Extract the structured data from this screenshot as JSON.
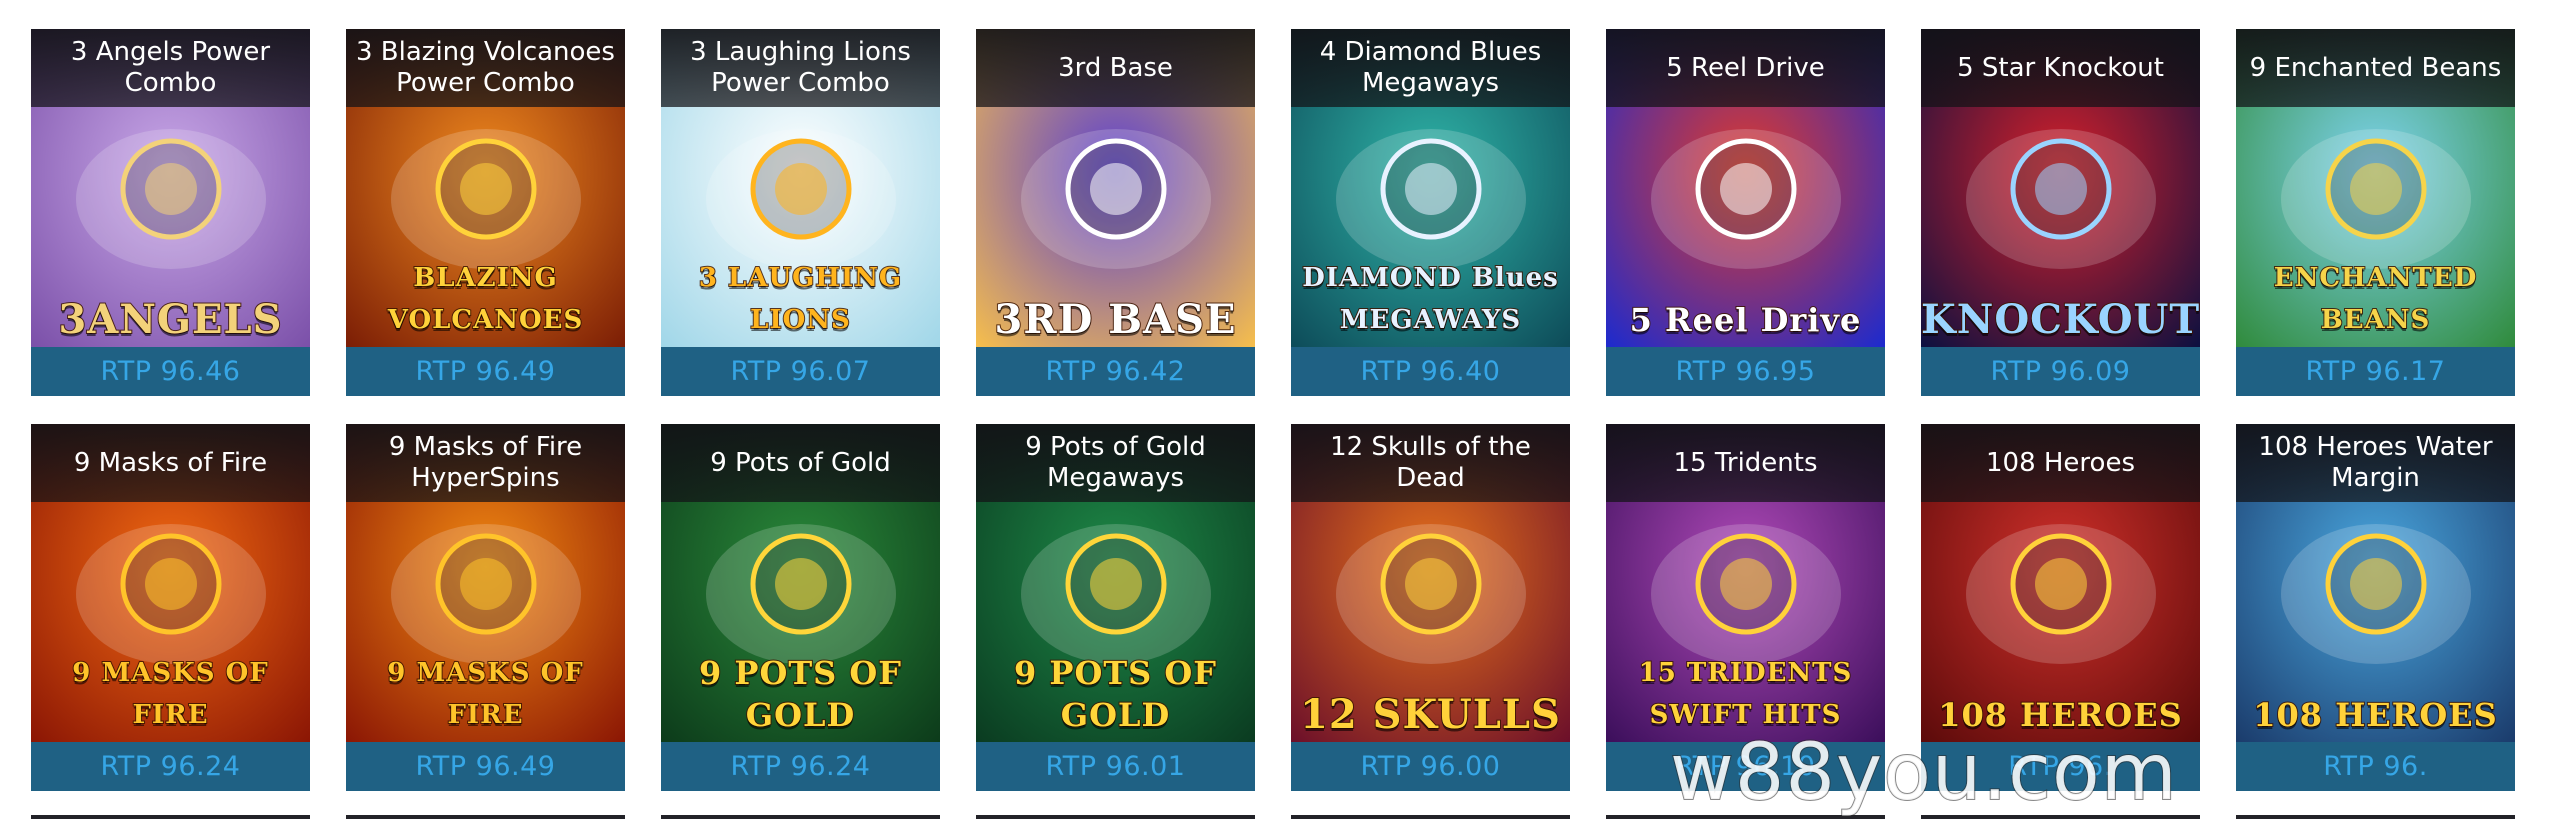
{
  "watermark": "w88you.com",
  "games": [
    {
      "title": "3 Angels Power Combo",
      "rtp": "RTP 96.46",
      "logo": "3ANGELS",
      "bg": [
        "#c9a8e8",
        "#7a4fa8"
      ],
      "logo_color": "#f3d27a",
      "thumb_icon": "angels-art"
    },
    {
      "title": "3 Blazing Volcanoes Power Combo",
      "rtp": "RTP 96.49",
      "logo": "BLAZING VOLCANOES",
      "bg": [
        "#f08a1e",
        "#7a1c05"
      ],
      "logo_color": "#ffd23a",
      "thumb_icon": "volcano-art"
    },
    {
      "title": "3 Laughing Lions Power Combo",
      "rtp": "RTP 96.07",
      "logo": "3 LAUGHING LIONS",
      "bg": [
        "#ffffff",
        "#9fd6e8"
      ],
      "logo_color": "#ffb41e",
      "thumb_icon": "lion-art"
    },
    {
      "title": "3rd Base",
      "rtp": "RTP 96.42",
      "logo": "3RD BASE",
      "bg": [
        "#5a3fd0",
        "#f8c04a"
      ],
      "logo_color": "#ffffff",
      "thumb_icon": "baseball-art"
    },
    {
      "title": "4 Diamond Blues Megaways",
      "rtp": "RTP 96.40",
      "logo": "DIAMOND Blues MEGAWAYS",
      "bg": [
        "#2fb5a8",
        "#0d4a58"
      ],
      "logo_color": "#e8f2ff",
      "thumb_icon": "diamond-art"
    },
    {
      "title": "5 Reel Drive",
      "rtp": "RTP 96.95",
      "logo": "5 Reel Drive",
      "bg": [
        "#e23a2a",
        "#1a2ad0"
      ],
      "logo_color": "#ffffff",
      "thumb_icon": "racecar-art"
    },
    {
      "title": "5 Star Knockout",
      "rtp": "RTP 96.09",
      "logo": "KNOCKOUT",
      "bg": [
        "#d8202a",
        "#0a1040"
      ],
      "logo_color": "#9ad4ff",
      "thumb_icon": "boxing-art"
    },
    {
      "title": "9 Enchanted Beans",
      "rtp": "RTP 96.17",
      "logo": "ENCHANTED BEANS",
      "bg": [
        "#7fd4f0",
        "#2f8a3a"
      ],
      "logo_color": "#f6d44a",
      "thumb_icon": "goose-art"
    },
    {
      "title": "9 Masks of Fire",
      "rtp": "RTP 96.24",
      "logo": "9 MASKS OF FIRE",
      "bg": [
        "#f26a12",
        "#8a1504"
      ],
      "logo_color": "#ffc42a",
      "thumb_icon": "mask-art"
    },
    {
      "title": "9 Masks of Fire HyperSpins",
      "rtp": "RTP 96.49",
      "logo": "9 MASKS OF FIRE",
      "bg": [
        "#f28a12",
        "#8a1504"
      ],
      "logo_color": "#ffc42a",
      "thumb_icon": "mask-art"
    },
    {
      "title": "9 Pots of Gold",
      "rtp": "RTP 96.24",
      "logo": "9 POTS OF GOLD",
      "bg": [
        "#2a8a3a",
        "#0c3a1a"
      ],
      "logo_color": "#ffd63a",
      "thumb_icon": "leprechaun-art"
    },
    {
      "title": "9 Pots of Gold Megaways",
      "rtp": "RTP 96.01",
      "logo": "9 POTS OF GOLD",
      "bg": [
        "#1e8a48",
        "#0a3a20"
      ],
      "logo_color": "#ffd63a",
      "thumb_icon": "leprechaun-art"
    },
    {
      "title": "12 Skulls of the Dead",
      "rtp": "RTP 96.00",
      "logo": "12 SKULLS",
      "bg": [
        "#e8731a",
        "#6a0e2a"
      ],
      "logo_color": "#ffd23a",
      "thumb_icon": "skull-art"
    },
    {
      "title": "15 Tridents",
      "rtp": "RTP 96.10",
      "logo": "15 TRIDENTS SWIFT HITS",
      "bg": [
        "#b04ab8",
        "#3a0e5a"
      ],
      "logo_color": "#ffd23a",
      "thumb_icon": "trident-art"
    },
    {
      "title": "108 Heroes",
      "rtp": "RTP 96.",
      "logo": "108 HEROES",
      "bg": [
        "#d0302a",
        "#5a0a0a"
      ],
      "logo_color": "#ffd23a",
      "thumb_icon": "heroes-art"
    },
    {
      "title": "108 Heroes Water Margin",
      "rtp": "RTP 96.",
      "logo": "108 HEROES",
      "bg": [
        "#4aa8e0",
        "#1a3a6a"
      ],
      "logo_color": "#ffd23a",
      "thumb_icon": "warriors-art"
    }
  ]
}
